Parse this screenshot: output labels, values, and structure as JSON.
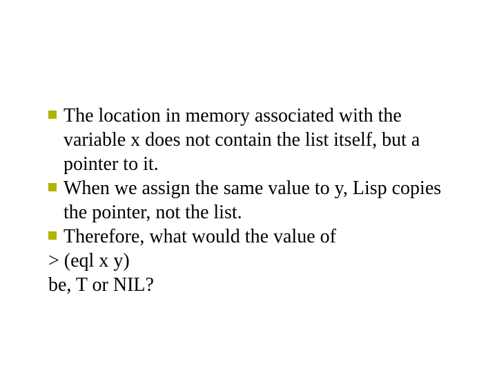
{
  "bullet_color": "#b2b200",
  "items": [
    {
      "text": "The location in memory associated with the variable x does not contain the list itself, but a pointer to it."
    },
    {
      "text": "When we assign the same value to y, Lisp copies the pointer, not the list."
    },
    {
      "text": "Therefore,  what would the value of"
    }
  ],
  "trailing": [
    ">  (eql  x  y)",
    "be,  T  or NIL?"
  ]
}
